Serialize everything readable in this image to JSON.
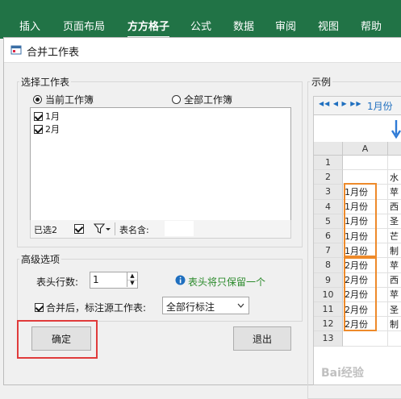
{
  "ribbon": {
    "tabs": [
      "插入",
      "页面布局",
      "方方格子",
      "公式",
      "数据",
      "审阅",
      "视图",
      "帮助"
    ],
    "active_tab": "方方格子"
  },
  "dialog": {
    "title": "合并工作表",
    "select_group": {
      "legend": "选择工作表",
      "radio_current": "当前工作簿",
      "radio_all": "全部工作簿",
      "sheets": [
        {
          "label": "1月",
          "checked": true
        },
        {
          "label": "2月",
          "checked": true
        }
      ],
      "selected_count": "已选2",
      "filter_icon": "filter-icon",
      "name_contains_label": "表名含:"
    },
    "example_group": {
      "legend": "示例",
      "sheet_tab_label": "1月份",
      "col_header": "A",
      "rows": [
        {
          "row": "1",
          "a": "",
          "b": ""
        },
        {
          "row": "2",
          "a": "",
          "b": "水"
        },
        {
          "row": "3",
          "a": "1月份",
          "b": "苹"
        },
        {
          "row": "4",
          "a": "1月份",
          "b": "西"
        },
        {
          "row": "5",
          "a": "1月份",
          "b": "圣"
        },
        {
          "row": "6",
          "a": "1月份",
          "b": "芒"
        },
        {
          "row": "7",
          "a": "1月份",
          "b": "制"
        },
        {
          "row": "8",
          "a": "2月份",
          "b": "苹"
        },
        {
          "row": "9",
          "a": "2月份",
          "b": "西"
        },
        {
          "row": "10",
          "a": "2月份",
          "b": "苹"
        },
        {
          "row": "11",
          "a": "2月份",
          "b": "圣"
        },
        {
          "row": "12",
          "a": "2月份",
          "b": "制"
        },
        {
          "row": "13",
          "a": "",
          "b": ""
        }
      ]
    },
    "advanced_group": {
      "legend": "高级选项",
      "header_rows_label": "表头行数:",
      "header_rows_value": "1",
      "info_text": "表头将只保留一个",
      "mark_source_label": "合并后，标注源工作表:",
      "mark_source_value": "全部行标注"
    },
    "ok_button": "确定",
    "exit_button": "退出"
  },
  "watermark": "Bai经验",
  "colors": {
    "ribbon": "#217346",
    "highlight_red": "#e03b3b",
    "highlight_orange": "#ee8a2a",
    "info_blue": "#1f6fbf"
  }
}
